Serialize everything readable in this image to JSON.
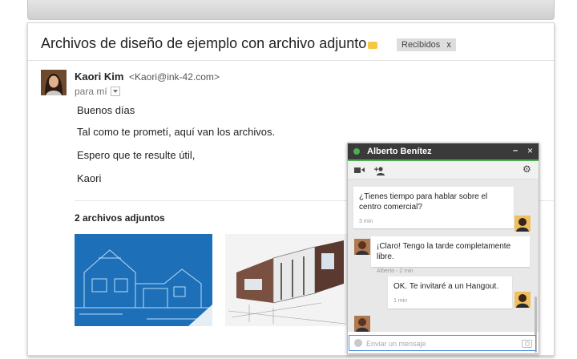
{
  "email": {
    "subject": "Archivos de diseño de ejemplo con archivo adjunto",
    "label": "Recibidos",
    "label_remove": "x",
    "sender_name": "Kaori Kim",
    "sender_email": "<Kaori@ink-42.com>",
    "recipient": "para mí",
    "body": [
      "Buenos días",
      "Tal como te prometí, aquí van los archivos.",
      "Espero que te resulte útil,",
      "Kaori"
    ],
    "attachments_title": "2 archivos adjuntos"
  },
  "chat": {
    "contact_name": "Alberto Benítez",
    "minimize": "–",
    "close": "×",
    "messages": [
      {
        "text": "¿Tienes tiempo para hablar sobre el centro comercial?",
        "meta": "3 min"
      },
      {
        "text": "¡Claro! Tengo la tarde completamente libre.",
        "meta": "Alberto - 2 min"
      },
      {
        "text": "OK. Te invitaré a un Hangout.",
        "meta": "1 min"
      }
    ],
    "input_placeholder": "Enviar un mensaje"
  },
  "colors": {
    "status_online": "#4caf50",
    "label_yellow": "#f5c842",
    "blueprint": "#1d6fb8",
    "input_focus": "#4f8fe0"
  }
}
